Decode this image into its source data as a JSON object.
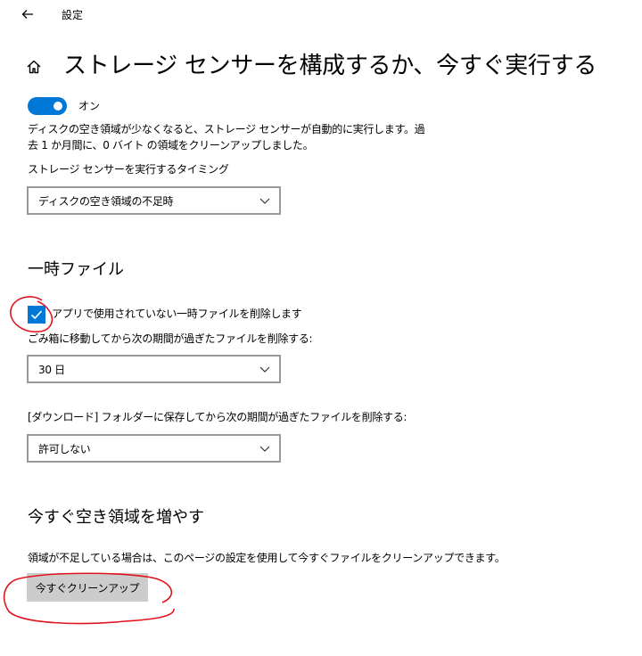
{
  "window": {
    "title": "設定"
  },
  "icons": {
    "back": "back-arrow-icon",
    "home": "home-icon",
    "chevron": "chevron-down-icon",
    "check": "checkmark-icon"
  },
  "colors": {
    "accent": "#0078d7",
    "select_border": "#999999",
    "button_bg": "#cccccc",
    "annotation": "#e0141e"
  },
  "header": {
    "title": "ストレージ センサーを構成するか、今すぐ実行する"
  },
  "storage_sense": {
    "toggle": {
      "state": "on",
      "label": "オン"
    },
    "description": "ディスクの空き領域が少なくなると、ストレージ センサーが自動的に実行します。過去 1 か月間に、0 バイト の領域をクリーンアップしました。",
    "run_timing": {
      "label": "ストレージ センサーを実行するタイミング",
      "selected": "ディスクの空き領域の不足時"
    }
  },
  "temp_files": {
    "heading": "一時ファイル",
    "delete_unused": {
      "checked": true,
      "label": "アプリで使用されていない一時ファイルを削除します"
    },
    "recycle_bin": {
      "label": "ごみ箱に移動してから次の期間が過ぎたファイルを削除する:",
      "selected": "30 日"
    },
    "downloads": {
      "label": "[ダウンロード] フォルダーに保存してから次の期間が過ぎたファイルを削除する:",
      "selected": "許可しない"
    }
  },
  "free_up": {
    "heading": "今すぐ空き領域を増やす",
    "description": "領域が不足している場合は、このページの設定を使用して今すぐファイルをクリーンアップできます。",
    "button_label": "今すぐクリーンアップ"
  }
}
